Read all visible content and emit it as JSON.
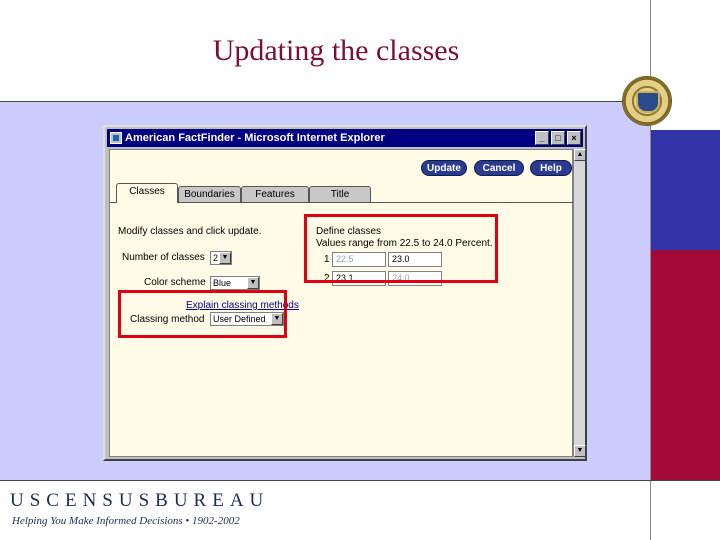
{
  "slide": {
    "title": "Updating the classes",
    "footer_org": "USCENSUSBUREAU",
    "footer_tagline": "Helping You Make Informed Decisions • 1902-2002"
  },
  "window": {
    "title": "American FactFinder - Microsoft Internet Explorer",
    "controls": {
      "minimize": "_",
      "maximize": "□",
      "close": "×"
    }
  },
  "toolbar": {
    "update_label": "Update",
    "cancel_label": "Cancel",
    "help_label": "Help"
  },
  "tabs": [
    {
      "label": "Classes",
      "active": true
    },
    {
      "label": "Boundaries",
      "active": false
    },
    {
      "label": "Features",
      "active": false
    },
    {
      "label": "Title",
      "active": false
    }
  ],
  "form": {
    "instruction": "Modify classes and click update.",
    "num_classes_label": "Number of classes",
    "num_classes_value": "2",
    "color_scheme_label": "Color scheme",
    "color_scheme_value": "Blue",
    "explain_link": "Explain classing methods",
    "classing_method_label": "Classing method",
    "classing_method_value": "User Defined"
  },
  "define": {
    "heading": "Define classes",
    "range_text": "Values range from 22.5 to 24.0 Percent.",
    "rows": [
      {
        "index": "1",
        "from": "22.5",
        "to": "23.0"
      },
      {
        "index": "2",
        "from": "23.1",
        "to": "24.0"
      }
    ]
  },
  "colors": {
    "title": "#7a1038",
    "panel": "#ccccff",
    "accent_blue": "#3434a8",
    "accent_red": "#a30a3a",
    "highlight": "#e00010"
  }
}
